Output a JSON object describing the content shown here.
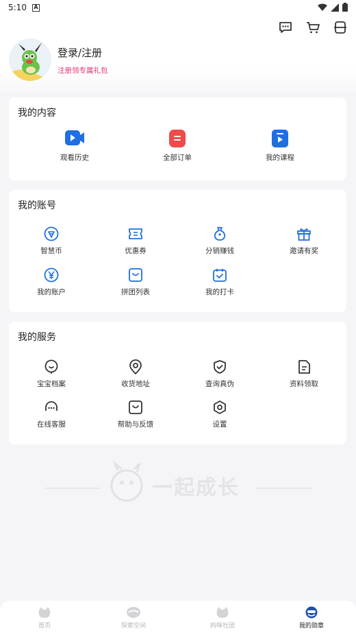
{
  "status_bar": {
    "time": "5:10",
    "notification_glyph": "A"
  },
  "header": {
    "icons": [
      "message-icon",
      "cart-icon",
      "scan-icon"
    ],
    "login_label": "登录/注册",
    "gift_label": "注册领专属礼包",
    "gift_color": "#e03677"
  },
  "my_content": {
    "title": "我的内容",
    "items": [
      {
        "label": "观看历史",
        "icon": "video-history-icon",
        "color": "#1f6fe0"
      },
      {
        "label": "全部订单",
        "icon": "order-icon",
        "color": "#f04a4a"
      },
      {
        "label": "我的课程",
        "icon": "course-icon",
        "color": "#1f6fe0"
      }
    ]
  },
  "my_account": {
    "title": "我的账号",
    "items": [
      {
        "label": "智慧币",
        "icon": "coin-icon"
      },
      {
        "label": "优惠券",
        "icon": "coupon-icon"
      },
      {
        "label": "分销赚钱",
        "icon": "money-bag-icon"
      },
      {
        "label": "邀请有奖",
        "icon": "gift-icon"
      },
      {
        "label": "我的账户",
        "icon": "yen-icon"
      },
      {
        "label": "拼团列表",
        "icon": "group-buy-icon"
      },
      {
        "label": "我的打卡",
        "icon": "check-in-icon"
      }
    ]
  },
  "my_services": {
    "title": "我的服务",
    "items": [
      {
        "label": "宝宝档案",
        "icon": "baby-icon"
      },
      {
        "label": "收货地址",
        "icon": "location-icon"
      },
      {
        "label": "查询真伪",
        "icon": "shield-check-icon"
      },
      {
        "label": "资料领取",
        "icon": "document-icon"
      },
      {
        "label": "在线客服",
        "icon": "customer-service-icon"
      },
      {
        "label": "帮助与反馈",
        "icon": "feedback-icon"
      },
      {
        "label": "设置",
        "icon": "settings-icon"
      }
    ]
  },
  "watermark": {
    "text": "一起成长"
  },
  "tabbar": {
    "items": [
      {
        "label": "首页",
        "icon": "home-tab-icon",
        "active": false
      },
      {
        "label": "探索空间",
        "icon": "explore-tab-icon",
        "active": false
      },
      {
        "label": "妈咪社团",
        "icon": "community-tab-icon",
        "active": false
      },
      {
        "label": "我的勋章",
        "icon": "profile-tab-icon",
        "active": true
      }
    ],
    "accent_color": "#1f6fe0"
  }
}
